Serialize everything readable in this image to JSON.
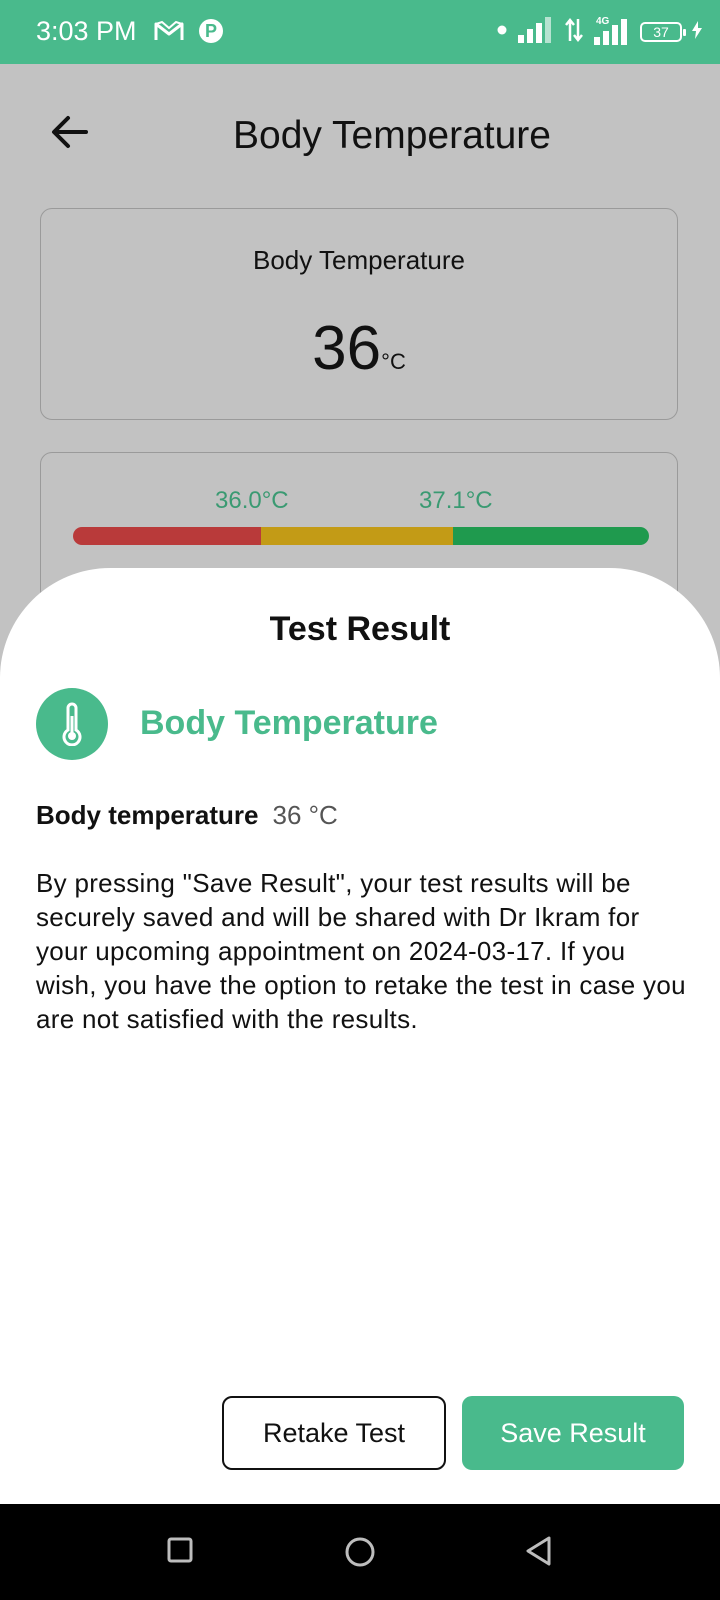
{
  "status_bar": {
    "time": "3:03 PM",
    "battery": "37",
    "icons": [
      "gmail-icon",
      "paytm-icon",
      "dot-icon",
      "signal-icon",
      "data-arrows-icon",
      "4g-signal-icon",
      "battery-icon",
      "charging-icon"
    ]
  },
  "header": {
    "title": "Body Temperature",
    "back_icon": "arrow-left-icon"
  },
  "value_card": {
    "label": "Body Temperature",
    "value": "36",
    "unit": "°C"
  },
  "range_card": {
    "low_threshold": "36.0°C",
    "high_threshold": "37.1°C",
    "segment_colors": [
      "#b93a3a",
      "#c39b16",
      "#1f9a4e"
    ]
  },
  "sheet": {
    "title": "Test Result",
    "icon": "thermometer-icon",
    "test_name": "Body Temperature",
    "measure_label": "Body temperature",
    "measure_value": "36 °C",
    "note": "By pressing \"Save Result\", your test results will be securely saved and will be shared with Dr Ikram for your upcoming appointment on 2024-03-17. If you wish, you have the option to retake the test in case you are not satisfied with the results.",
    "retake_label": "Retake Test",
    "save_label": "Save Result"
  },
  "nav_bar": {
    "icons": [
      "square-recents-icon",
      "circle-home-icon",
      "triangle-back-icon"
    ]
  },
  "colors": {
    "accent": "#49ba8c",
    "overlay": "#c2c2c2"
  }
}
